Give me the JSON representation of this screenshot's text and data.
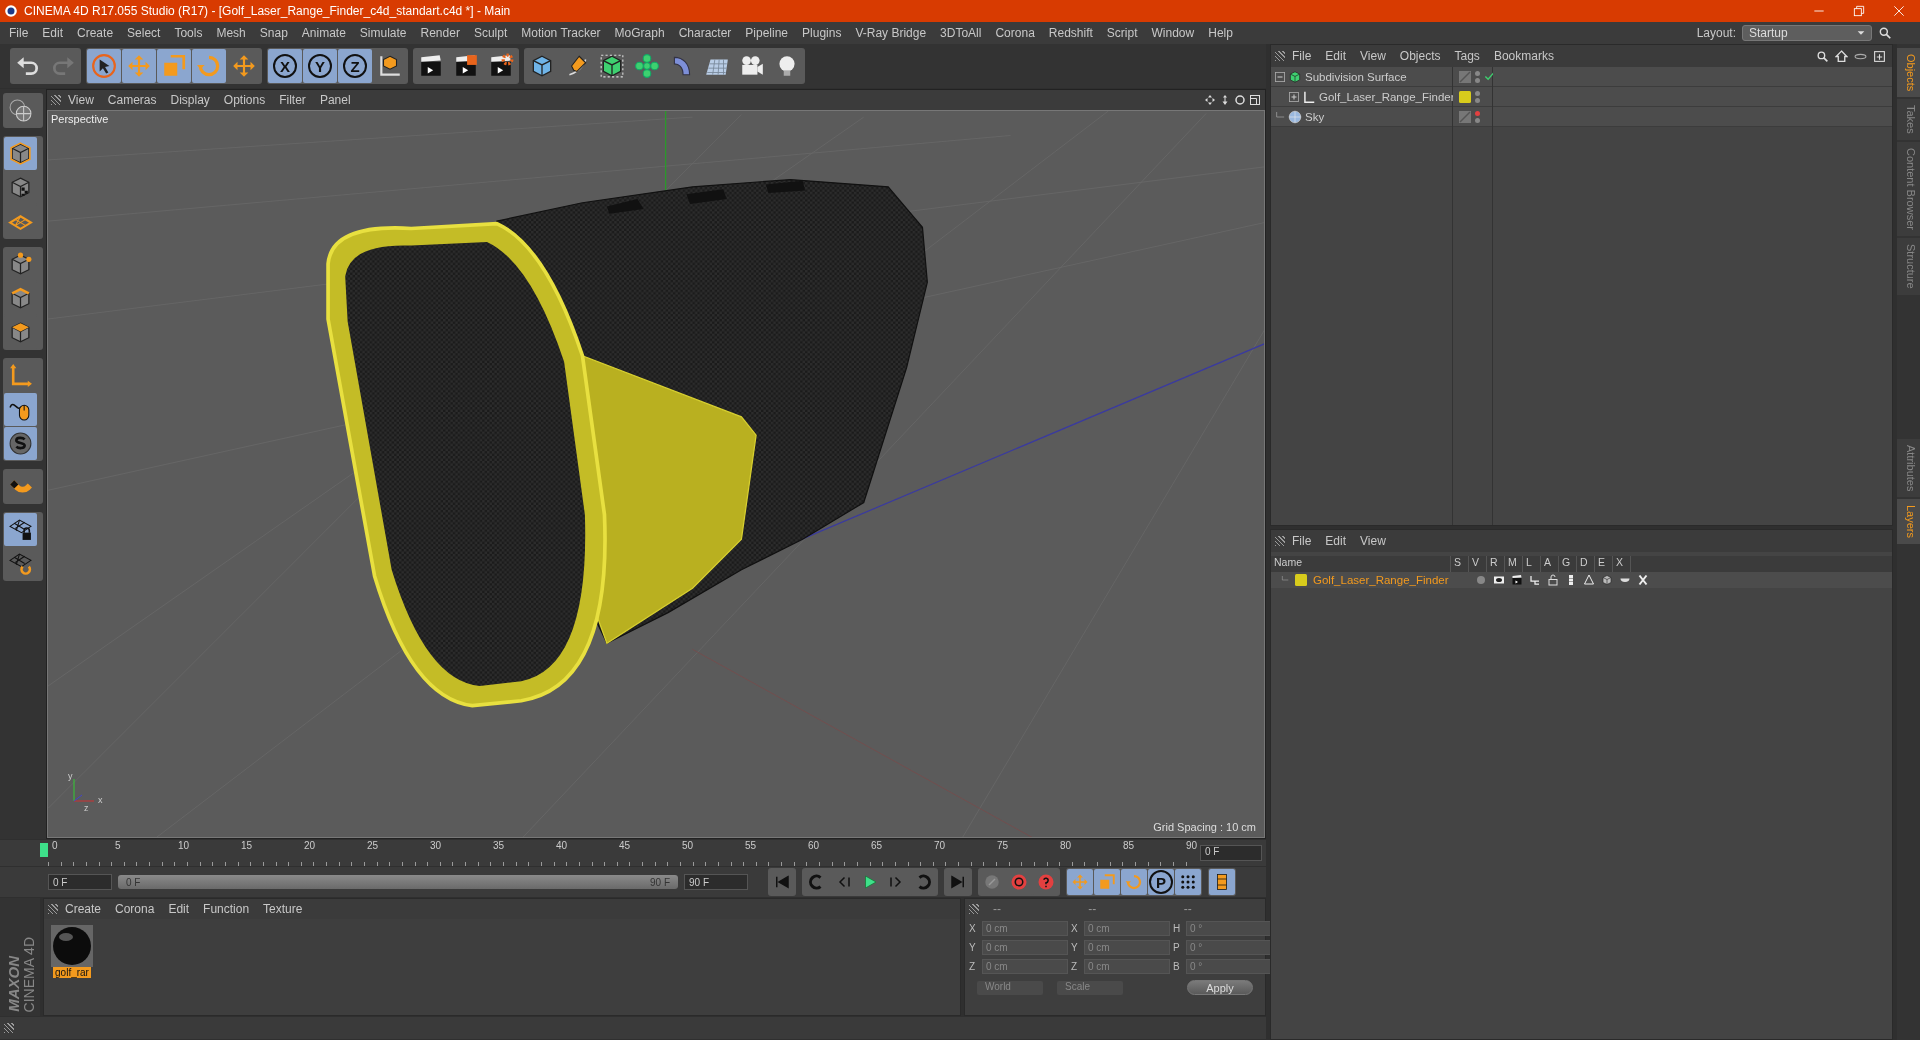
{
  "window": {
    "title": "CINEMA 4D R17.055 Studio (R17) - [Golf_Laser_Range_Finder_c4d_standart.c4d *] - Main"
  },
  "menu": [
    "File",
    "Edit",
    "Create",
    "Select",
    "Tools",
    "Mesh",
    "Snap",
    "Animate",
    "Simulate",
    "Render",
    "Sculpt",
    "Motion Tracker",
    "MoGraph",
    "Character",
    "Pipeline",
    "Plugins",
    "V-Ray Bridge",
    "3DToAll",
    "Corona",
    "Redshift",
    "Script",
    "Window",
    "Help"
  ],
  "layout": {
    "label": "Layout:",
    "value": "Startup"
  },
  "toolbar": [
    [
      {
        "kind": "undo",
        "active": false
      },
      {
        "kind": "redo",
        "active": false
      }
    ],
    [
      {
        "kind": "select",
        "active": true
      },
      {
        "kind": "move",
        "active": true
      },
      {
        "kind": "scale",
        "active": true
      },
      {
        "kind": "rotate",
        "active": true
      },
      {
        "kind": "transform",
        "active": false
      }
    ],
    [
      {
        "kind": "axis",
        "label": "X",
        "active": true
      },
      {
        "kind": "axis",
        "label": "Y",
        "active": true
      },
      {
        "kind": "axis",
        "label": "Z",
        "active": true
      },
      {
        "kind": "coords",
        "active": false
      }
    ],
    [
      {
        "kind": "render",
        "active": false
      },
      {
        "kind": "renderview",
        "active": false
      },
      {
        "kind": "rendersettings",
        "active": false
      }
    ],
    [
      {
        "kind": "cube",
        "active": false
      },
      {
        "kind": "pen",
        "active": false
      },
      {
        "kind": "subdiv",
        "active": false
      },
      {
        "kind": "cloner",
        "active": false
      },
      {
        "kind": "deformer",
        "active": false
      },
      {
        "kind": "floor",
        "active": false
      },
      {
        "kind": "camera",
        "active": false
      },
      {
        "kind": "light",
        "active": false
      }
    ]
  ],
  "left_tools": [
    [
      {
        "kind": "editable",
        "active": false
      }
    ],
    [
      {
        "kind": "model",
        "active": true
      },
      {
        "kind": "texture",
        "active": false
      },
      {
        "kind": "workplane",
        "active": false
      }
    ],
    [
      {
        "kind": "points",
        "active": false
      },
      {
        "kind": "edges",
        "active": false
      },
      {
        "kind": "polygons",
        "active": false
      }
    ],
    [
      {
        "kind": "axes",
        "active": false
      },
      {
        "kind": "tweak",
        "active": true
      },
      {
        "kind": "snap",
        "active": true
      }
    ],
    [
      {
        "kind": "magnet",
        "active": false
      }
    ],
    [
      {
        "kind": "lockplane",
        "active": true
      },
      {
        "kind": "syncplane",
        "active": false
      }
    ]
  ],
  "viewport": {
    "menu": [
      "View",
      "Cameras",
      "Display",
      "Options",
      "Filter",
      "Panel"
    ],
    "camera": "Perspective",
    "grid_spacing": "Grid Spacing : 10 cm",
    "gizmo": [
      "y",
      "x",
      "z"
    ]
  },
  "timeline": {
    "ticks": [
      "0",
      "5",
      "10",
      "15",
      "20",
      "25",
      "30",
      "35",
      "40",
      "45",
      "50",
      "55",
      "60",
      "65",
      "70",
      "75",
      "80",
      "85",
      "90"
    ],
    "current": "0 F"
  },
  "transport": {
    "start": "0 F",
    "range": {
      "start": "0 F",
      "end": "90 F",
      "level": 1
    },
    "end": "90 F",
    "buttons": [
      [
        {
          "kind": "first",
          "active": false
        }
      ],
      [
        {
          "kind": "prevkey",
          "active": false
        },
        {
          "kind": "prev",
          "active": false
        },
        {
          "kind": "play",
          "active": false
        },
        {
          "kind": "next",
          "active": false
        },
        {
          "kind": "nextkey",
          "active": false
        }
      ],
      [
        {
          "kind": "last",
          "active": false
        }
      ],
      [
        {
          "kind": "keyframe",
          "active": false
        },
        {
          "kind": "record",
          "active": false
        },
        {
          "kind": "autokey",
          "active": false
        }
      ],
      [
        {
          "kind": "move",
          "active": true
        },
        {
          "kind": "scale",
          "active": true
        },
        {
          "kind": "rotate",
          "active": true
        },
        {
          "kind": "param",
          "label": "P",
          "active": true
        },
        {
          "kind": "pla",
          "active": true
        }
      ],
      [
        {
          "kind": "timeline",
          "active": true
        }
      ]
    ]
  },
  "materials": {
    "menu": [
      "Create",
      "Corona",
      "Edit",
      "Function",
      "Texture"
    ],
    "items": [
      {
        "name": "golf_rar",
        "selected": true
      }
    ]
  },
  "logo": {
    "brand": "MAXON",
    "product": "CINEMA 4D"
  },
  "coords": {
    "headers": [
      "--",
      "--",
      "--"
    ],
    "rows": [
      {
        "label": "X",
        "value": "0 cm",
        "label2": "X",
        "value2": "0 cm",
        "label3": "H",
        "value3": "0 °"
      },
      {
        "label": "Y",
        "value": "0 cm",
        "label2": "Y",
        "value2": "0 cm",
        "label3": "P",
        "value3": "0 °"
      },
      {
        "label": "Z",
        "value": "0 cm",
        "label2": "Z",
        "value2": "0 cm",
        "label3": "B",
        "value3": "0 °"
      }
    ],
    "mode": "World",
    "mode2": "Scale",
    "apply": "Apply"
  },
  "objects": {
    "menu": [
      "File",
      "Edit",
      "View",
      "Objects",
      "Tags",
      "Bookmarks"
    ],
    "tree": [
      {
        "name": "Subdivision Surface",
        "kind": "subdiv",
        "expanded": true,
        "editor_visible": true,
        "enabled": true,
        "children": [
          {
            "name": "Golf_Laser_Range_Finder",
            "kind": "null",
            "expanded": false,
            "editor_visible": true,
            "color": "#d8cc1c"
          }
        ]
      },
      {
        "name": "Sky",
        "kind": "sky",
        "editor_visible": false
      }
    ]
  },
  "layers": {
    "menu": [
      "File",
      "Edit",
      "View"
    ],
    "columns": [
      "Name",
      "S",
      "V",
      "R",
      "M",
      "L",
      "A",
      "G",
      "D",
      "E",
      "X"
    ],
    "rows": [
      {
        "name": "Golf_Laser_Range_Finder",
        "color": "#d8cc1c"
      }
    ]
  },
  "side_tabs": [
    {
      "label": "Objects",
      "selected": true
    },
    {
      "label": "Takes",
      "selected": false
    },
    {
      "label": "Content Browser",
      "selected": false
    },
    {
      "label": "Structure",
      "selected": false
    }
  ],
  "side_tabs_lower": [
    {
      "label": "Attributes",
      "selected": false
    },
    {
      "label": "Layers",
      "selected": true
    }
  ]
}
